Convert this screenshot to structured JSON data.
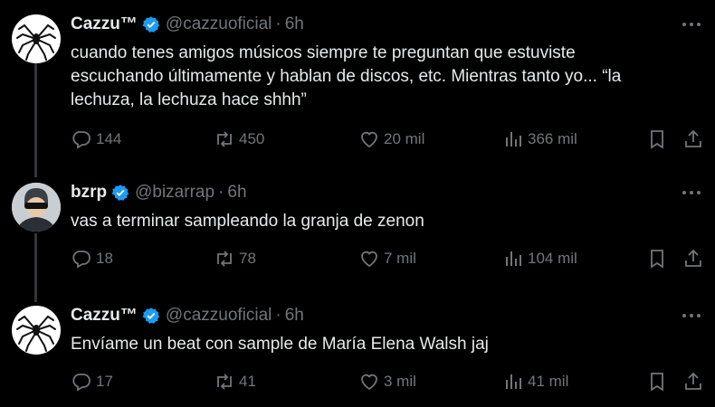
{
  "tweets": [
    {
      "name": "Cazzu™",
      "handle": "@cazzuoficial",
      "time": "6h",
      "text": "cuando tenes amigos músicos siempre te preguntan que estuviste\nescuchando últimamente y hablan de discos, etc. Mientras tanto yo... “la\nlechuza, la lechuza hace shhh”",
      "replies": "144",
      "retweets": "450",
      "likes": "20 mil",
      "views": "366 mil"
    },
    {
      "name": "bzrp",
      "handle": "@bizarrap",
      "time": "6h",
      "text": "vas a terminar sampleando la granja de zenon",
      "replies": "18",
      "retweets": "78",
      "likes": "7 mil",
      "views": "104 mil"
    },
    {
      "name": "Cazzu™",
      "handle": "@cazzuoficial",
      "time": "6h",
      "text": "Envíame un beat con sample de María Elena Walsh jaj",
      "replies": "17",
      "retweets": "41",
      "likes": "3 mil",
      "views": "41 mil"
    }
  ],
  "separator": "·",
  "colors": {
    "background": "#000000",
    "text": "#e7e9ea",
    "muted": "#71767b",
    "verified": "#1d9bf0",
    "thread_line": "#333639"
  },
  "icons": {
    "reply": "reply-icon",
    "retweet": "retweet-icon",
    "like": "heart-icon",
    "views": "views-icon",
    "bookmark": "bookmark-icon",
    "share": "share-icon",
    "more": "more-icon",
    "verified": "verified-badge-icon"
  }
}
